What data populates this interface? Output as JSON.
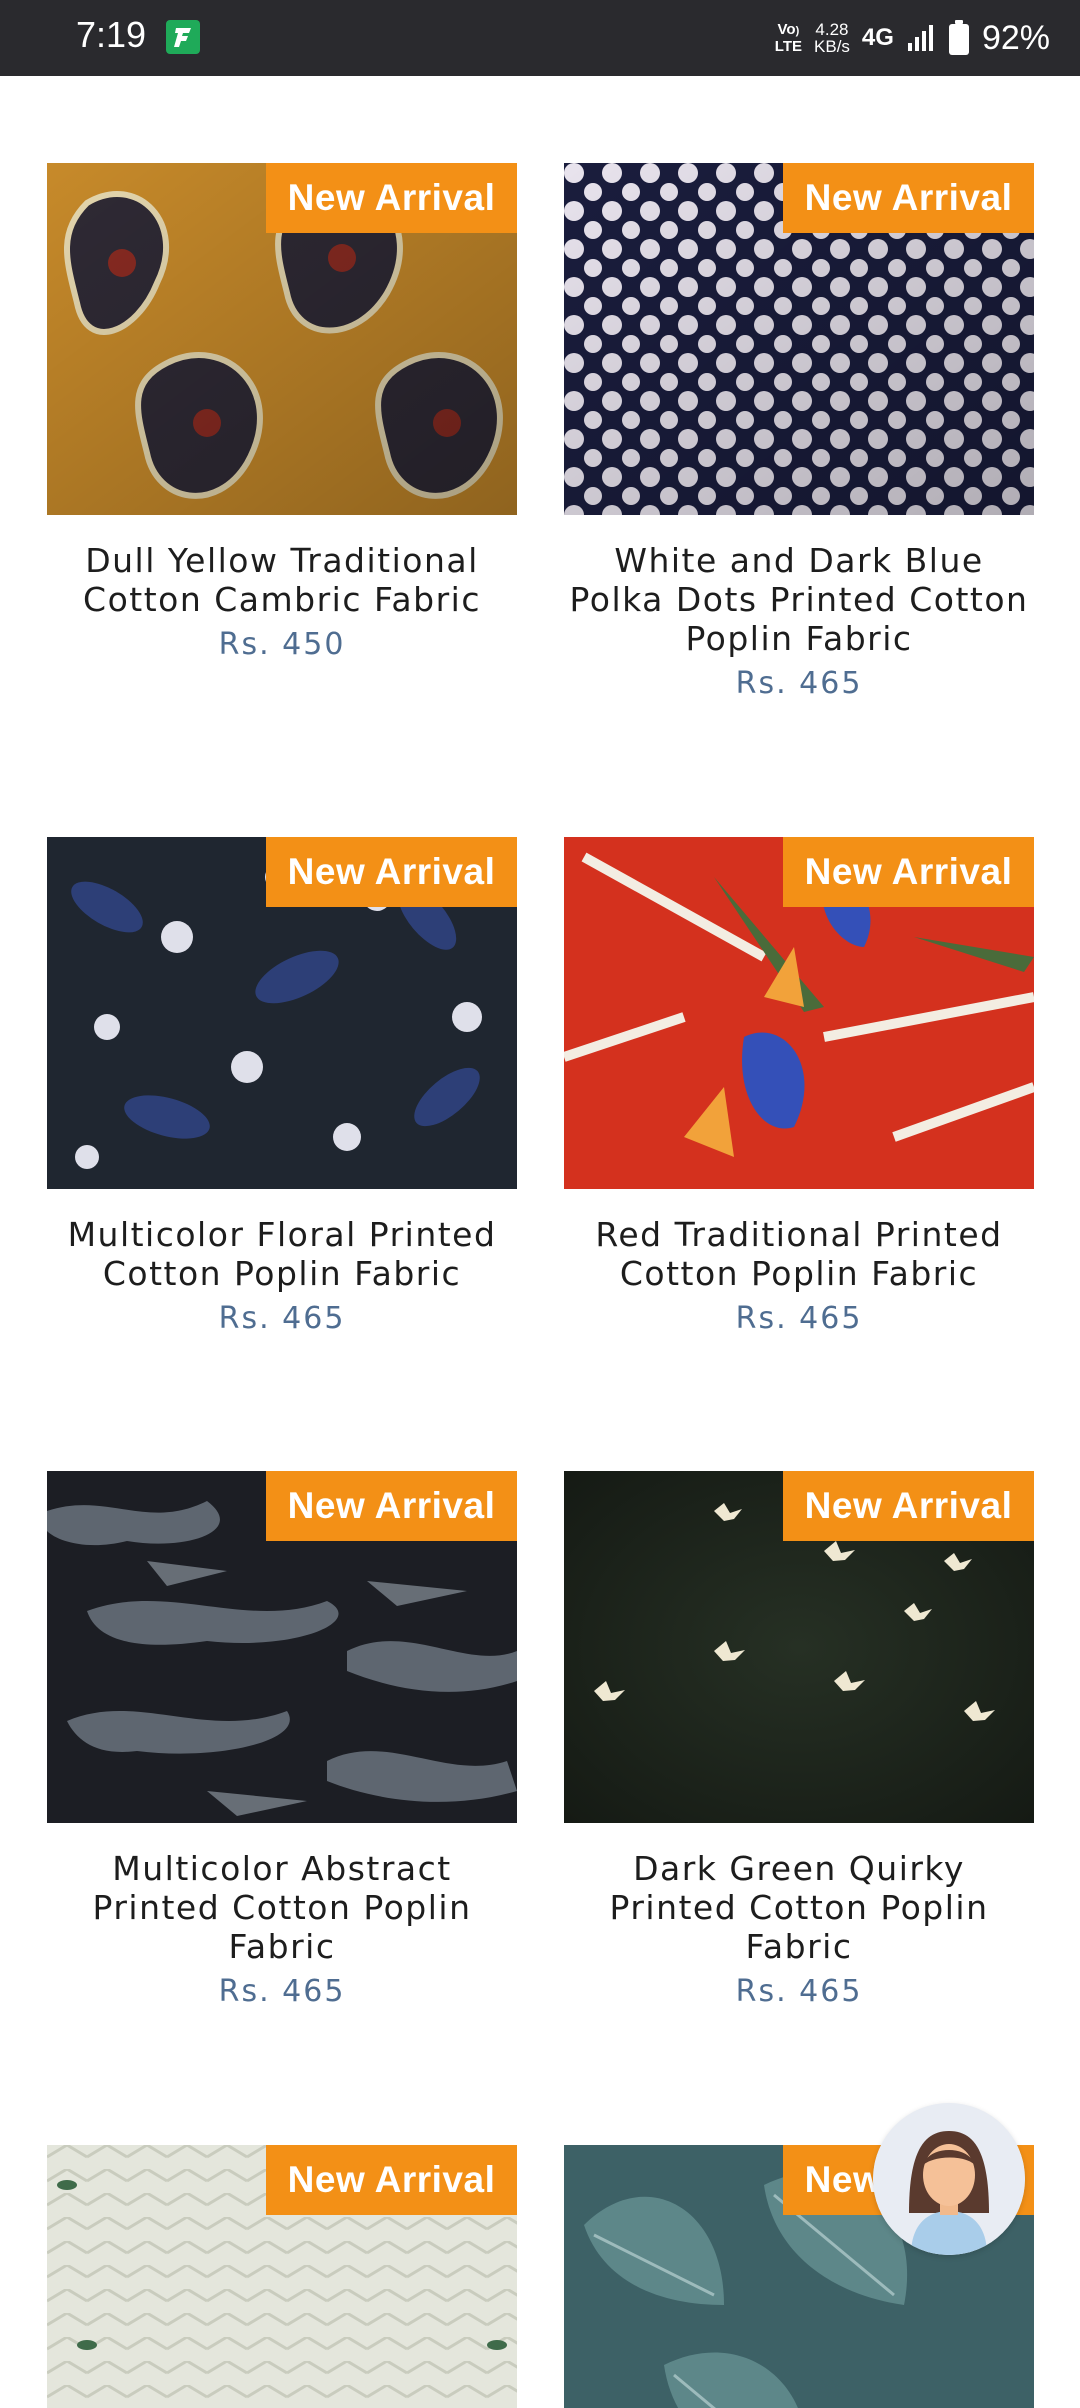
{
  "status_bar": {
    "time": "7:19",
    "volte_top": "VoLTE",
    "volte_bottom": "LTE",
    "speed_value": "4.28",
    "speed_unit": "KB/s",
    "network": "4G",
    "battery": "92%",
    "app_icon": "wallet-icon"
  },
  "badge_color": "#f39016",
  "price_color": "#4f6d91",
  "products": [
    {
      "badge": "New Arrival",
      "title": "Dull Yellow Traditional Cotton Cambric Fabric",
      "price": "Rs. 450"
    },
    {
      "badge": "New Arrival",
      "title": "White and Dark Blue Polka Dots Printed Cotton Poplin Fabric",
      "price": "Rs. 465"
    },
    {
      "badge": "New Arrival",
      "title": "Multicolor Floral Printed Cotton Poplin Fabric",
      "price": "Rs. 465"
    },
    {
      "badge": "New Arrival",
      "title": "Red Traditional Printed Cotton Poplin Fabric",
      "price": "Rs. 465"
    },
    {
      "badge": "New Arrival",
      "title": "Multicolor Abstract Printed Cotton Poplin Fabric",
      "price": "Rs. 465"
    },
    {
      "badge": "New Arrival",
      "title": "Dark Green Quirky Printed Cotton Poplin Fabric",
      "price": "Rs. 465"
    },
    {
      "badge": "New Arrival"
    },
    {
      "badge": "New Arrival"
    }
  ],
  "chat": {
    "icon": "chat-assistant-avatar-icon"
  }
}
